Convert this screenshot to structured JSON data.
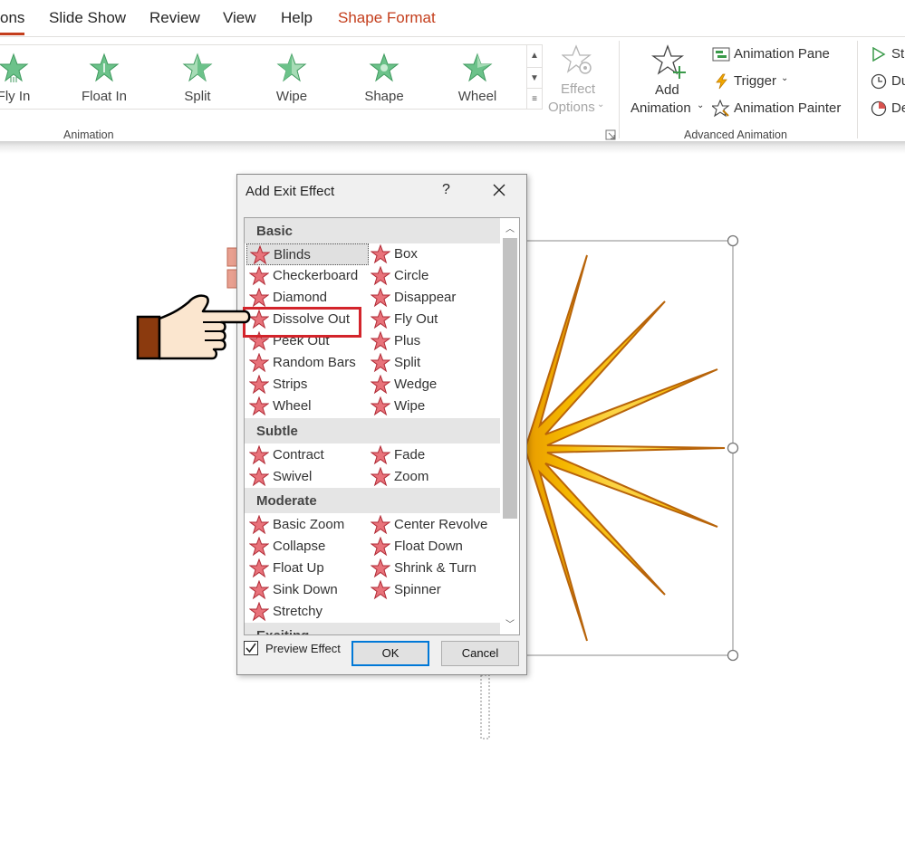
{
  "menu": {
    "tabs": [
      "ons",
      "Slide Show",
      "Review",
      "View",
      "Help",
      "Shape Format"
    ]
  },
  "ribbon": {
    "gallery_items": [
      "Fly In",
      "Float In",
      "Split",
      "Wipe",
      "Shape",
      "Wheel"
    ],
    "effect_options": {
      "line1": "Effect",
      "line2": "Options"
    },
    "add_animation": {
      "line1": "Add",
      "line2": "Animation"
    },
    "animation_pane": "Animation Pane",
    "trigger": "Trigger",
    "animation_painter": "Animation Painter",
    "group_animation": "Animation",
    "group_advanced": "Advanced Animation",
    "timing_partial": [
      "St",
      "Du",
      "De"
    ]
  },
  "dialog": {
    "title": "Add Exit Effect",
    "help": "?",
    "categories": {
      "basic": "Basic",
      "subtle": "Subtle",
      "moderate": "Moderate",
      "exciting": "Exciting"
    },
    "basic_effects": [
      "Blinds",
      "Box",
      "Checkerboard",
      "Circle",
      "Diamond",
      "Disappear",
      "Dissolve Out",
      "Fly Out",
      "Peek Out",
      "Plus",
      "Random Bars",
      "Split",
      "Strips",
      "Wedge",
      "Wheel",
      "Wipe"
    ],
    "subtle_effects": [
      "Contract",
      "Fade",
      "Swivel",
      "Zoom"
    ],
    "moderate_effects": [
      "Basic Zoom",
      "Center Revolve",
      "Collapse",
      "Float Down",
      "Float Up",
      "Shrink & Turn",
      "Sink Down",
      "Spinner",
      "Stretchy"
    ],
    "selected_effect": "Blinds",
    "preview_effect_label": "Preview Effect",
    "preview_effect_checked": true,
    "ok_label": "OK",
    "cancel_label": "Cancel"
  },
  "colors": {
    "accent": "#c43e1c",
    "star_fill": "#e8727a",
    "gallery_star": "#6cc28a",
    "highlight_box": "#d3242b",
    "sunburst": "#f5b800",
    "sunburst_outline": "#b8640a"
  }
}
